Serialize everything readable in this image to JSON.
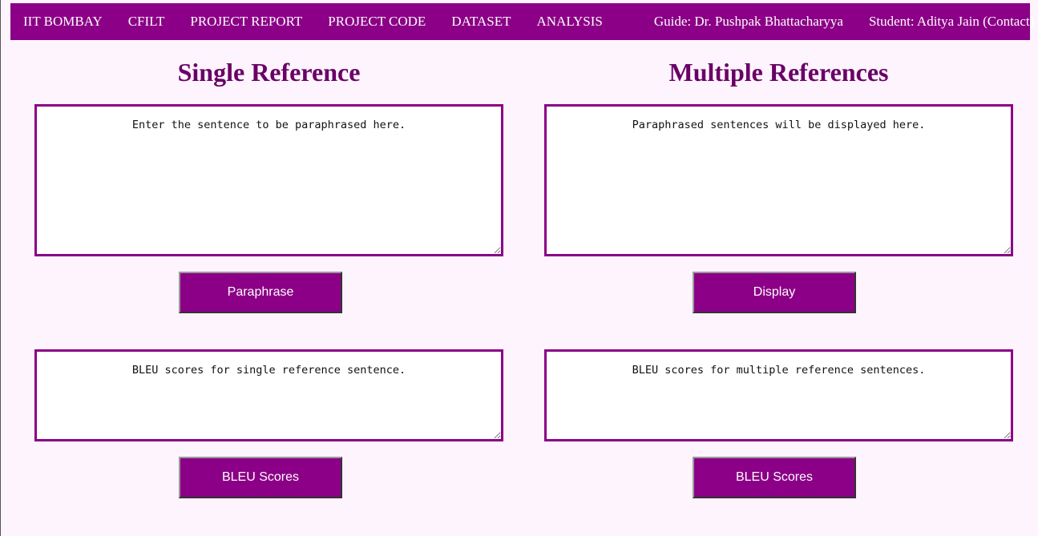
{
  "nav": {
    "left": [
      {
        "label": "IIT BOMBAY"
      },
      {
        "label": "CFILT"
      },
      {
        "label": "PROJECT REPORT"
      },
      {
        "label": "PROJECT CODE"
      },
      {
        "label": "DATASET"
      },
      {
        "label": "ANALYSIS"
      }
    ],
    "guide": "Guide: Dr. Pushpak Bhattacharyya",
    "student": "Student: Aditya Jain (Contact)"
  },
  "colors": {
    "accent": "#8b0086",
    "heading": "#6a0066",
    "background": "#fdf4fd"
  },
  "single": {
    "title": "Single Reference",
    "input_placeholder": "Enter the sentence to be paraphrased here.",
    "paraphrase_button": "Paraphrase",
    "bleu_placeholder": "BLEU scores for single reference sentence.",
    "bleu_button": "BLEU Scores"
  },
  "multiple": {
    "title": "Multiple References",
    "output_placeholder": "Paraphrased sentences will be displayed here.",
    "display_button": "Display",
    "bleu_placeholder": "BLEU scores for multiple reference sentences.",
    "bleu_button": "BLEU Scores"
  }
}
